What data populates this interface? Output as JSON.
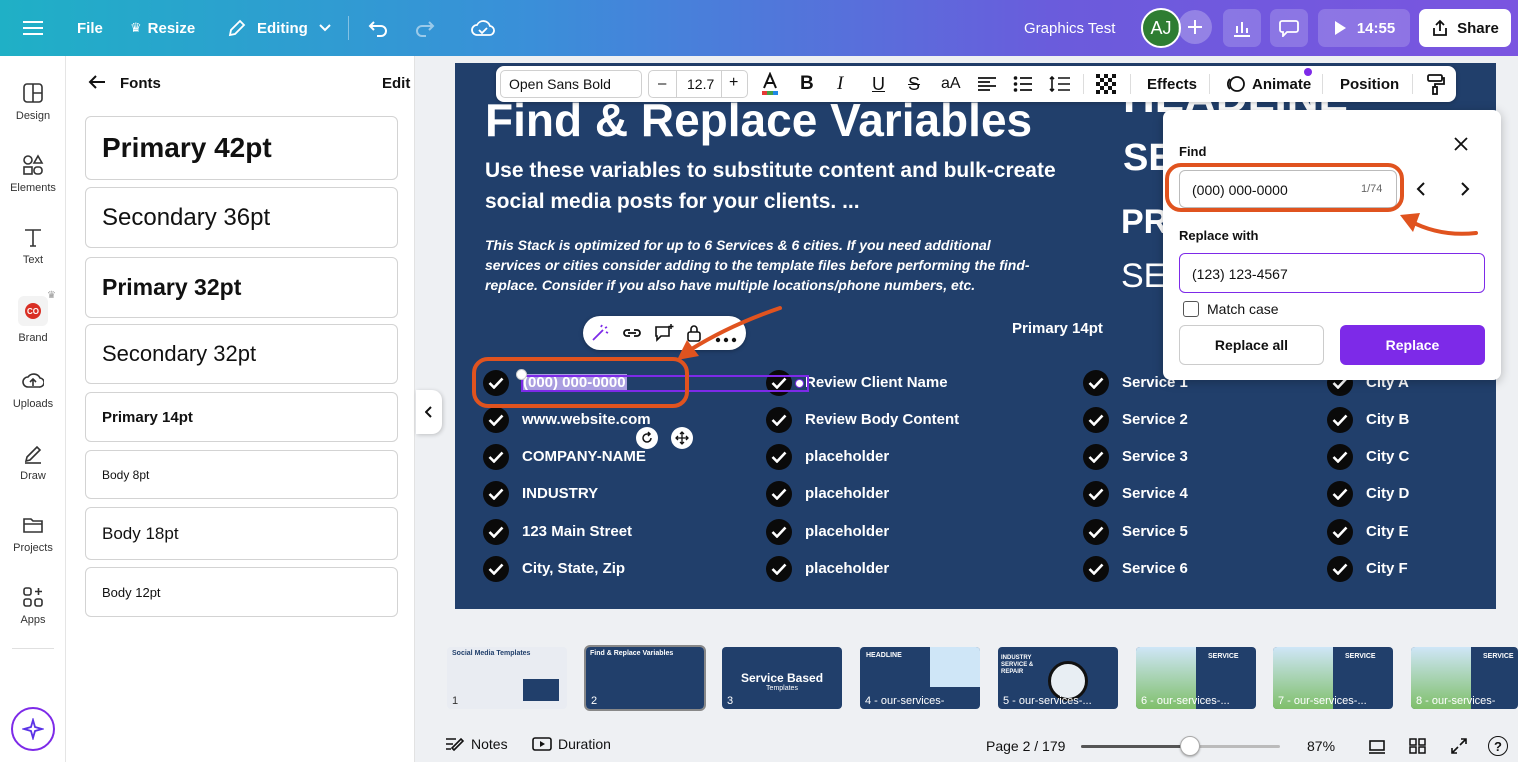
{
  "topbar": {
    "file": "File",
    "resize": "Resize",
    "editing": "Editing",
    "doc_title": "Graphics Test",
    "avatar_initials": "AJ",
    "timer": "14:55",
    "share": "Share"
  },
  "rail": {
    "items": [
      {
        "label": "Design",
        "icon": "design-icon"
      },
      {
        "label": "Elements",
        "icon": "elements-icon"
      },
      {
        "label": "Text",
        "icon": "text-icon"
      },
      {
        "label": "Brand",
        "icon": "brand-icon",
        "badge": "co"
      },
      {
        "label": "Uploads",
        "icon": "uploads-icon"
      },
      {
        "label": "Draw",
        "icon": "draw-icon"
      },
      {
        "label": "Projects",
        "icon": "projects-icon"
      },
      {
        "label": "Apps",
        "icon": "apps-icon"
      }
    ]
  },
  "fonts_panel": {
    "title": "Fonts",
    "edit": "Edit",
    "fonts": [
      {
        "label": "Primary 42pt"
      },
      {
        "label": "Secondary 36pt"
      },
      {
        "label": "Primary 32pt"
      },
      {
        "label": "Secondary 32pt"
      },
      {
        "label": "Primary 14pt"
      },
      {
        "label": "Body 8pt"
      },
      {
        "label": "Body 18pt"
      },
      {
        "label": "Body 12pt"
      }
    ]
  },
  "toolbar": {
    "font": "Open Sans Bold",
    "font_size": "12.7",
    "minus": "–",
    "plus": "+",
    "text_case": "aA",
    "effects": "Effects",
    "animate": "Animate",
    "position": "Position"
  },
  "canvas": {
    "title": "Find & Replace Variables",
    "subtitle": "Use these variables to substitute content and bulk-create social media posts for your clients. ...",
    "italic_note": "This Stack is optimized for up to 6 Services & 6 cities. If you need additional services or cities consider adding to the template files before performing the find-replace. Consider if you also have multiple locations/phone numbers, etc.",
    "label_primary14": "Primary 14pt",
    "right_partial_1": "HEADLINE",
    "right_partial_2": "SE",
    "right_partial_3": "PR",
    "right_partial_4": "SE",
    "col1": [
      "(000) 000-0000",
      "www.website.com",
      "COMPANY-NAME",
      "INDUSTRY",
      "123 Main Street",
      "City, State, Zip"
    ],
    "col2": [
      "Review Client Name",
      "Review Body Content",
      "placeholder",
      "placeholder",
      "placeholder",
      "placeholder"
    ],
    "col3": [
      "Service 1",
      "Service 2",
      "Service 3",
      "Service 4",
      "Service 5",
      "Service 6"
    ],
    "col4": [
      "City A",
      "City B",
      "City C",
      "City D",
      "City E",
      "City F"
    ]
  },
  "find_replace": {
    "find_label": "Find",
    "find_value": "(000) 000-0000",
    "find_count": "1/74",
    "replace_label": "Replace with",
    "replace_value": "(123) 123-4567",
    "match_case": "Match case",
    "replace_all": "Replace all",
    "replace": "Replace"
  },
  "thumbnails": [
    {
      "label": "1",
      "title": "Social Media Templates"
    },
    {
      "label": "2",
      "title": "Find & Replace Variables"
    },
    {
      "label": "3",
      "title": "Service Based",
      "sub": "Templates"
    },
    {
      "label": "4 - our-services-",
      "title": "HEADLINE"
    },
    {
      "label": "5 - our-services-...",
      "title": "INDUSTRY SERVICE & REPAIR"
    },
    {
      "label": "6 - our-services-...",
      "title": "SERVICE"
    },
    {
      "label": "7 - our-services-...",
      "title": "SERVICE"
    },
    {
      "label": "8 - our-services-",
      "title": "SERVICE"
    }
  ],
  "bottombar": {
    "notes": "Notes",
    "duration": "Duration",
    "page": "Page 2 / 179",
    "zoom": "87%",
    "help": "?"
  },
  "colors": {
    "canvas_bg": "#213f6b",
    "accent_purple": "#7d2ae8",
    "annotation_orange": "#e0531f"
  }
}
